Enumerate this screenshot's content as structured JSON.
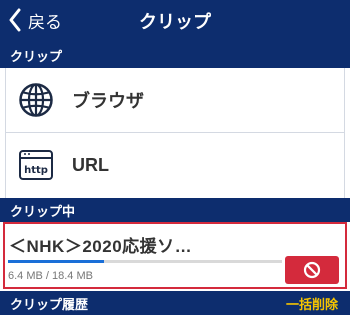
{
  "navbar": {
    "back_label": "戻る",
    "title": "クリップ"
  },
  "sections": {
    "clip": "クリップ",
    "active": "クリップ中",
    "history": "クリップ履歴",
    "history_action": "一括削除"
  },
  "clip_options": [
    {
      "label": "ブラウザ",
      "icon": "globe-icon"
    },
    {
      "label": "URL",
      "icon": "http-icon",
      "icon_text": "http"
    }
  ],
  "active_clip": {
    "title": "＜NHK＞2020応援ソ…",
    "size_text": "6.4 MB / 18.4 MB",
    "progress": 0.35,
    "stop_icon": "stop-icon"
  },
  "colors": {
    "nav_bg": "#0d2d6e",
    "accent_yellow": "#f5c400",
    "highlight_red": "#d42a3c",
    "progress_blue": "#1a6fd8"
  }
}
